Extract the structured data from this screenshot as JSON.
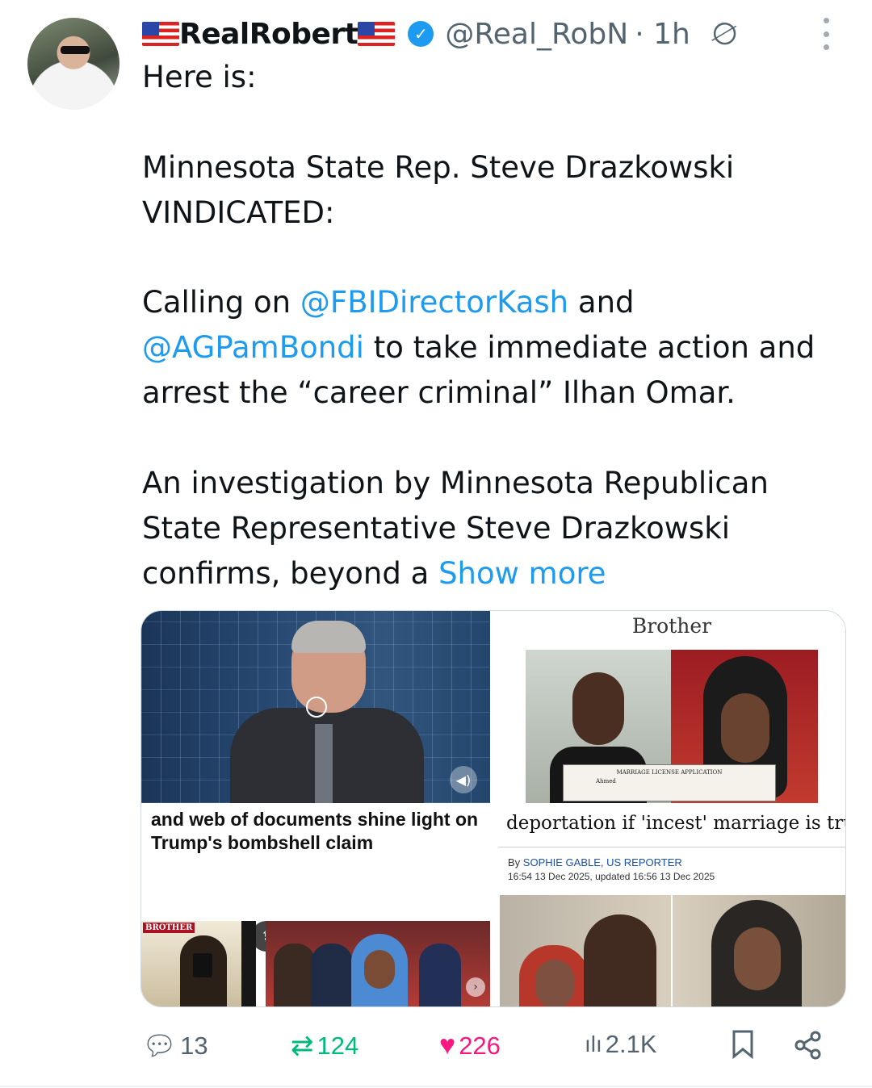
{
  "author": {
    "display_name": "RealRobert",
    "handle": "@Real_RobN",
    "time": "· 1h"
  },
  "icons": {
    "avatar": "avatar",
    "verified": "verified-badge-icon",
    "grok": "grok-icon",
    "more": "more-options-icon",
    "reply": "reply-icon",
    "retweet": "retweet-icon",
    "like": "heart-icon",
    "views": "views-icon",
    "bookmark": "bookmark-icon",
    "share": "share-icon",
    "verified_glyph": "✓",
    "grok_glyph": "∅"
  },
  "tweet": {
    "line1": "Here is:",
    "para2": "Minnesota State Rep. Steve Drazkowski VINDICATED:",
    "para3_pre": "Calling on ",
    "mention1": "@FBIDirectorKash",
    "para3_mid": " and ",
    "mention2": "@AGPamBondi",
    "para3_post": " to take immediate action and arrest the “career criminal” Ilhan Omar.",
    "para4": "An investigation by Minnesota Republican State Representative Steve Drazkowski confirms, beyond a ",
    "show_more": "Show more"
  },
  "media": {
    "tile2_title": "Brother",
    "tile2_doc_line1": "MARRIAGE LICENSE APPLICATION",
    "tile2_doc_line2": "Ahmed",
    "tile3_headline": "and web of documents shine light on Trump's bombshell claim",
    "tile3_tag": "BROTHER",
    "share_icons": [
      "f",
      "✆",
      "♎",
      "⇪"
    ],
    "tile4_headline": "deportation if 'incest' marriage is true",
    "tile4_by": "By ",
    "tile4_reporter": "SOPHIE GABLE, US REPORTER",
    "tile4_stamp": "16:54 13 Dec 2025, updated 16:56 13 Dec 2025"
  },
  "actions": {
    "replies": "13",
    "retweets": "124",
    "likes": "226",
    "views": "2.1K"
  },
  "colors": {
    "accent": "#1d9bf0",
    "retweet": "#00ba7c",
    "like": "#f91880",
    "muted": "#536471"
  }
}
